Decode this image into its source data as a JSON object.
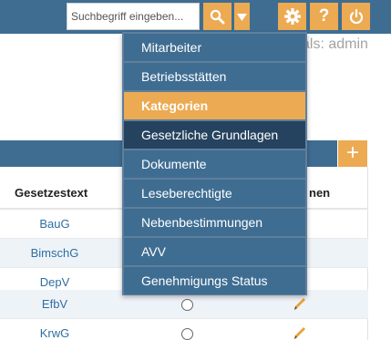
{
  "topbar": {
    "search_placeholder": "Suchbegriff eingeben...",
    "icons": [
      "search-icon",
      "caret-down-icon",
      "gear-icon",
      "question-icon",
      "power-icon"
    ],
    "help_label": "?"
  },
  "userline": "als: admin",
  "panel": {
    "add_label": "+"
  },
  "table": {
    "header_name": "Gesetzestext",
    "header_rest": "nen",
    "rows": [
      "BauG",
      "BimschG",
      "DepV",
      "EfbV",
      "KrwG"
    ]
  },
  "menu": {
    "items": [
      "Mitarbeiter",
      "Betriebsstätten",
      "Kategorien",
      "Gesetzliche Grundlagen",
      "Dokumente",
      "Leseberechtigte",
      "Nebenbestimmungen",
      "AVV",
      "Genehmigungs Status"
    ],
    "active_item": "Kategorien",
    "hover_item": "Gesetzliche Grundlagen"
  },
  "colors": {
    "primary": "#3f6d92",
    "accent": "#ecaa52",
    "menu_hover": "#25435e",
    "link": "#2f6ea0",
    "pencil": "#e8a33a"
  }
}
